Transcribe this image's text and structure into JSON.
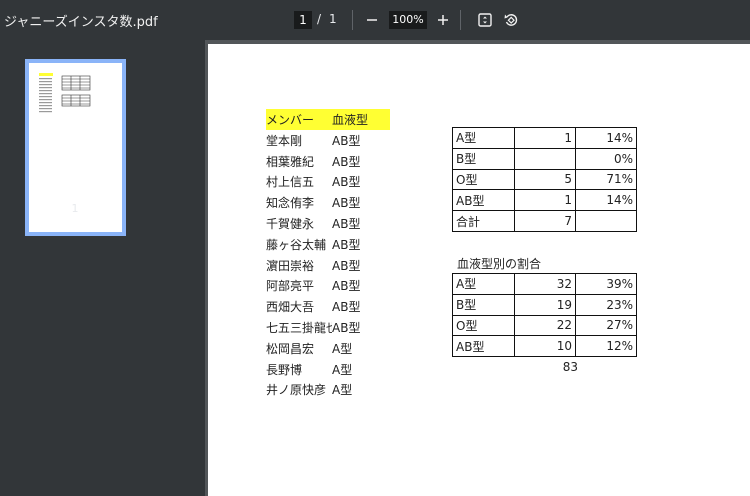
{
  "toolbar": {
    "filename": "ジャニーズインスタ数.pdf",
    "current_page": "1",
    "page_sep": "/",
    "total_pages": "1",
    "zoom": "100%",
    "zoom_out_icon": "minus-icon",
    "zoom_in_icon": "plus-icon",
    "fit_icon": "fit-page-icon",
    "rotate_icon": "rotate-icon"
  },
  "sidebar": {
    "thumbnail_page_label": "1",
    "selected_border_color": "#8ab4f8"
  },
  "document": {
    "member_header": {
      "name": "メンバー",
      "blood": "血液型",
      "highlight_color": "#ffff33"
    },
    "members": [
      {
        "name": "堂本剛",
        "blood": "AB型"
      },
      {
        "name": "相葉雅紀",
        "blood": "AB型"
      },
      {
        "name": "村上信五",
        "blood": "AB型"
      },
      {
        "name": "知念侑李",
        "blood": "AB型"
      },
      {
        "name": "千賀健永",
        "blood": "AB型"
      },
      {
        "name": "藤ヶ谷太輔",
        "blood": "AB型"
      },
      {
        "name": "濵田崇裕",
        "blood": "AB型"
      },
      {
        "name": "阿部亮平",
        "blood": "AB型"
      },
      {
        "name": "西畑大吾",
        "blood": "AB型"
      },
      {
        "name": "七五三掛龍也",
        "blood": "AB型"
      },
      {
        "name": "松岡昌宏",
        "blood": "A型"
      },
      {
        "name": "長野博",
        "blood": "A型"
      },
      {
        "name": "井ノ原快彦",
        "blood": "A型"
      }
    ],
    "table1": [
      {
        "type": "A型",
        "count": "1",
        "pct": "14%"
      },
      {
        "type": "B型",
        "count": "",
        "pct": "0%"
      },
      {
        "type": "O型",
        "count": "5",
        "pct": "71%"
      },
      {
        "type": "AB型",
        "count": "1",
        "pct": "14%"
      },
      {
        "type": "合計",
        "count": "7",
        "pct": ""
      }
    ],
    "table2_caption": "血液型別の割合",
    "table2": [
      {
        "type": "A型",
        "count": "32",
        "pct": "39%"
      },
      {
        "type": "B型",
        "count": "19",
        "pct": "23%"
      },
      {
        "type": "O型",
        "count": "22",
        "pct": "27%"
      },
      {
        "type": "AB型",
        "count": "10",
        "pct": "12%"
      }
    ],
    "table2_total": "83"
  }
}
